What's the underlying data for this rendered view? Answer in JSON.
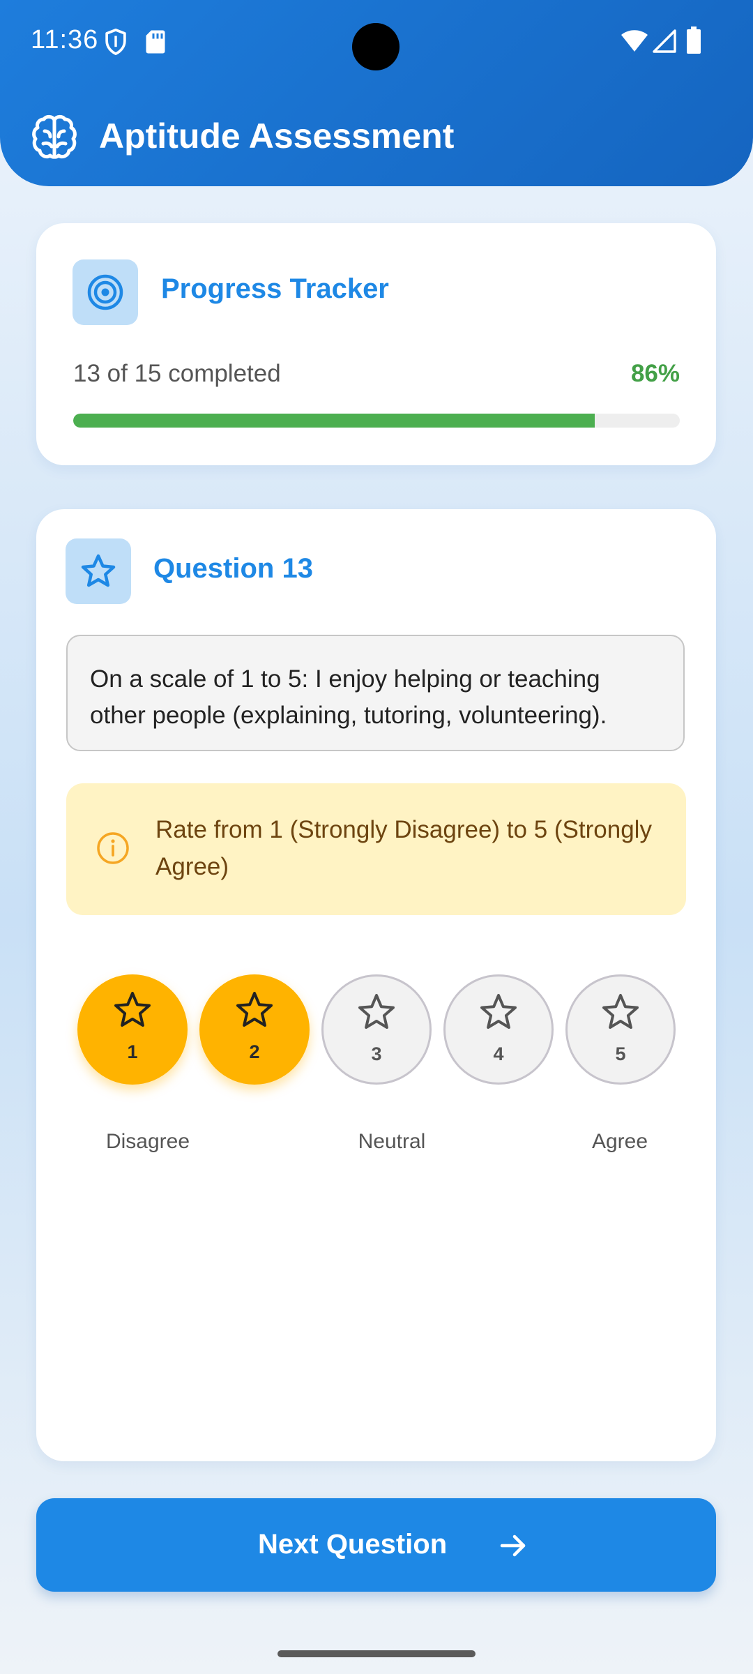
{
  "status_bar": {
    "time": "11:36",
    "icons": [
      "shield-icon",
      "sd-card-icon",
      "wifi-icon",
      "signal-icon",
      "battery-icon"
    ]
  },
  "header": {
    "title": "Aptitude Assessment",
    "icon": "brain-icon",
    "color": "#1e7ddc"
  },
  "progress": {
    "title": "Progress Tracker",
    "icon": "target-icon",
    "count_text": "13 of 15 completed",
    "percent_text": "86%",
    "fraction": 0.86,
    "fill_color": "#4caf50"
  },
  "question": {
    "title": "Question 13",
    "icon": "star-outline-icon",
    "text": "On a scale of 1 to 5: I enjoy helping or teaching other people (explaining, tutoring, volunteering).",
    "hint": "Rate from 1 (Strongly Disagree) to 5 (Strongly Agree)",
    "hint_icon": "info-icon"
  },
  "rating": {
    "options": [
      {
        "label": "1",
        "selected": true
      },
      {
        "label": "2",
        "selected": true
      },
      {
        "label": "3",
        "selected": false
      },
      {
        "label": "4",
        "selected": false
      },
      {
        "label": "5",
        "selected": false
      }
    ],
    "selected_value": 2,
    "selected_color": "#ffb300",
    "scale_labels": {
      "low": "Disagree",
      "mid": "Neutral",
      "high": "Agree"
    }
  },
  "actions": {
    "next_label": "Next Question",
    "next_icon": "arrow-right-icon",
    "button_color": "#1e88e5"
  }
}
